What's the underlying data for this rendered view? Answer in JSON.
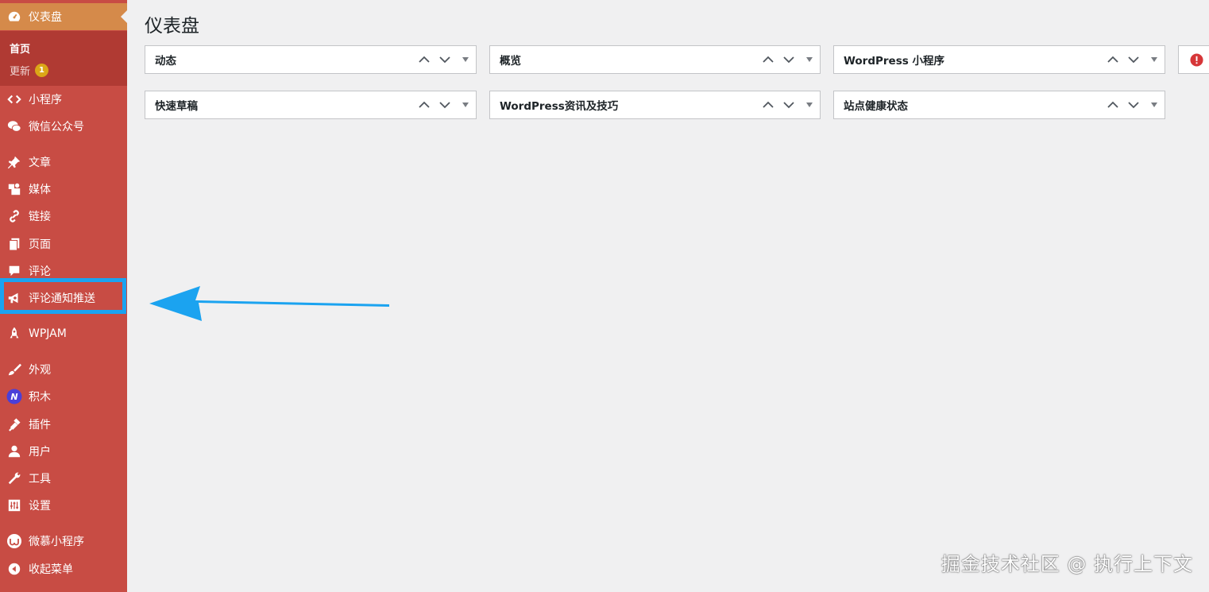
{
  "sidebar": {
    "dashboard": {
      "label": "仪表盘",
      "icon": "dashboard-gauge-icon"
    },
    "submenu": {
      "home": "首页",
      "updates": "更新",
      "update_count": "1"
    },
    "items": [
      {
        "id": "miniprogram",
        "label": "小程序",
        "icon": "code-brackets-icon"
      },
      {
        "id": "wechat",
        "label": "微信公众号",
        "icon": "wechat-icon"
      },
      {
        "id": "posts",
        "label": "文章",
        "icon": "pin-icon"
      },
      {
        "id": "media",
        "label": "媒体",
        "icon": "media-icon"
      },
      {
        "id": "links",
        "label": "链接",
        "icon": "link-icon"
      },
      {
        "id": "pages",
        "label": "页面",
        "icon": "page-icon"
      },
      {
        "id": "comments",
        "label": "评论",
        "icon": "comment-bubble-icon"
      },
      {
        "id": "comment-push",
        "label": "评论通知推送",
        "icon": "megaphone-icon"
      },
      {
        "id": "wpjam",
        "label": "WPJAM",
        "icon": "rocket-icon"
      },
      {
        "id": "appearance",
        "label": "外观",
        "icon": "paintbrush-icon"
      },
      {
        "id": "jimu",
        "label": "积木",
        "icon": "jimu-logo-icon"
      },
      {
        "id": "plugins",
        "label": "插件",
        "icon": "plug-icon"
      },
      {
        "id": "users",
        "label": "用户",
        "icon": "user-icon"
      },
      {
        "id": "tools",
        "label": "工具",
        "icon": "wrench-icon"
      },
      {
        "id": "settings",
        "label": "设置",
        "icon": "sliders-icon"
      },
      {
        "id": "weimu",
        "label": "微慕小程序",
        "icon": "weimu-logo-icon"
      },
      {
        "id": "collapse",
        "label": "收起菜单",
        "icon": "collapse-arrow-icon"
      }
    ]
  },
  "main": {
    "title": "仪表盘",
    "widgets": [
      {
        "title": "动态"
      },
      {
        "title": "概览"
      },
      {
        "title": "WordPress 小程序"
      },
      {
        "title": "快速草稿"
      },
      {
        "title": "WordPress资讯及技巧"
      },
      {
        "title": "站点健康状态"
      }
    ],
    "partial_widget_icon": "error-alert-icon"
  },
  "annotation": {
    "color": "#1ba3f0"
  },
  "watermark": "掘金技术社区 @ 执行上下文",
  "colors": {
    "sidebar_bg": "#c84c44",
    "current_bg": "#d58a4a",
    "submenu_bg": "#b03a33",
    "badge": "#dba617",
    "content_bg": "#f0f0f1"
  }
}
